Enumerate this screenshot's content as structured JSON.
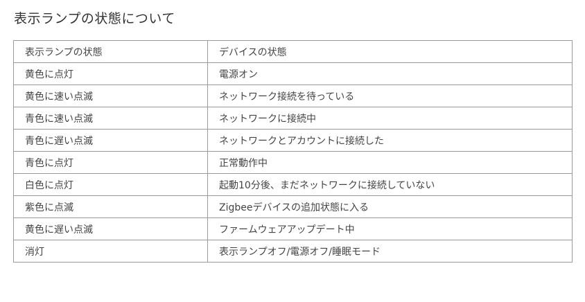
{
  "title": "表示ランプの状態について",
  "table": {
    "headers": [
      "表示ランプの状態",
      "デバイスの状態"
    ],
    "rows": [
      [
        "黄色に点灯",
        "電源オン"
      ],
      [
        "黄色に速い点滅",
        "ネットワーク接続を待っている"
      ],
      [
        "青色に速い点滅",
        "ネットワークに接続中"
      ],
      [
        "青色に遅い点滅",
        "ネットワークとアカウントに接続した"
      ],
      [
        "青色に点灯",
        "正常動作中"
      ],
      [
        "白色に点灯",
        "起動10分後、まだネットワークに接続していない"
      ],
      [
        "紫色に点滅",
        "Zigbeeデバイスの追加状態に入る"
      ],
      [
        "黄色に遅い点滅",
        "ファームウェアアップデート中"
      ],
      [
        "消灯",
        "表示ランプオフ/電源オフ/睡眠モード"
      ]
    ]
  }
}
